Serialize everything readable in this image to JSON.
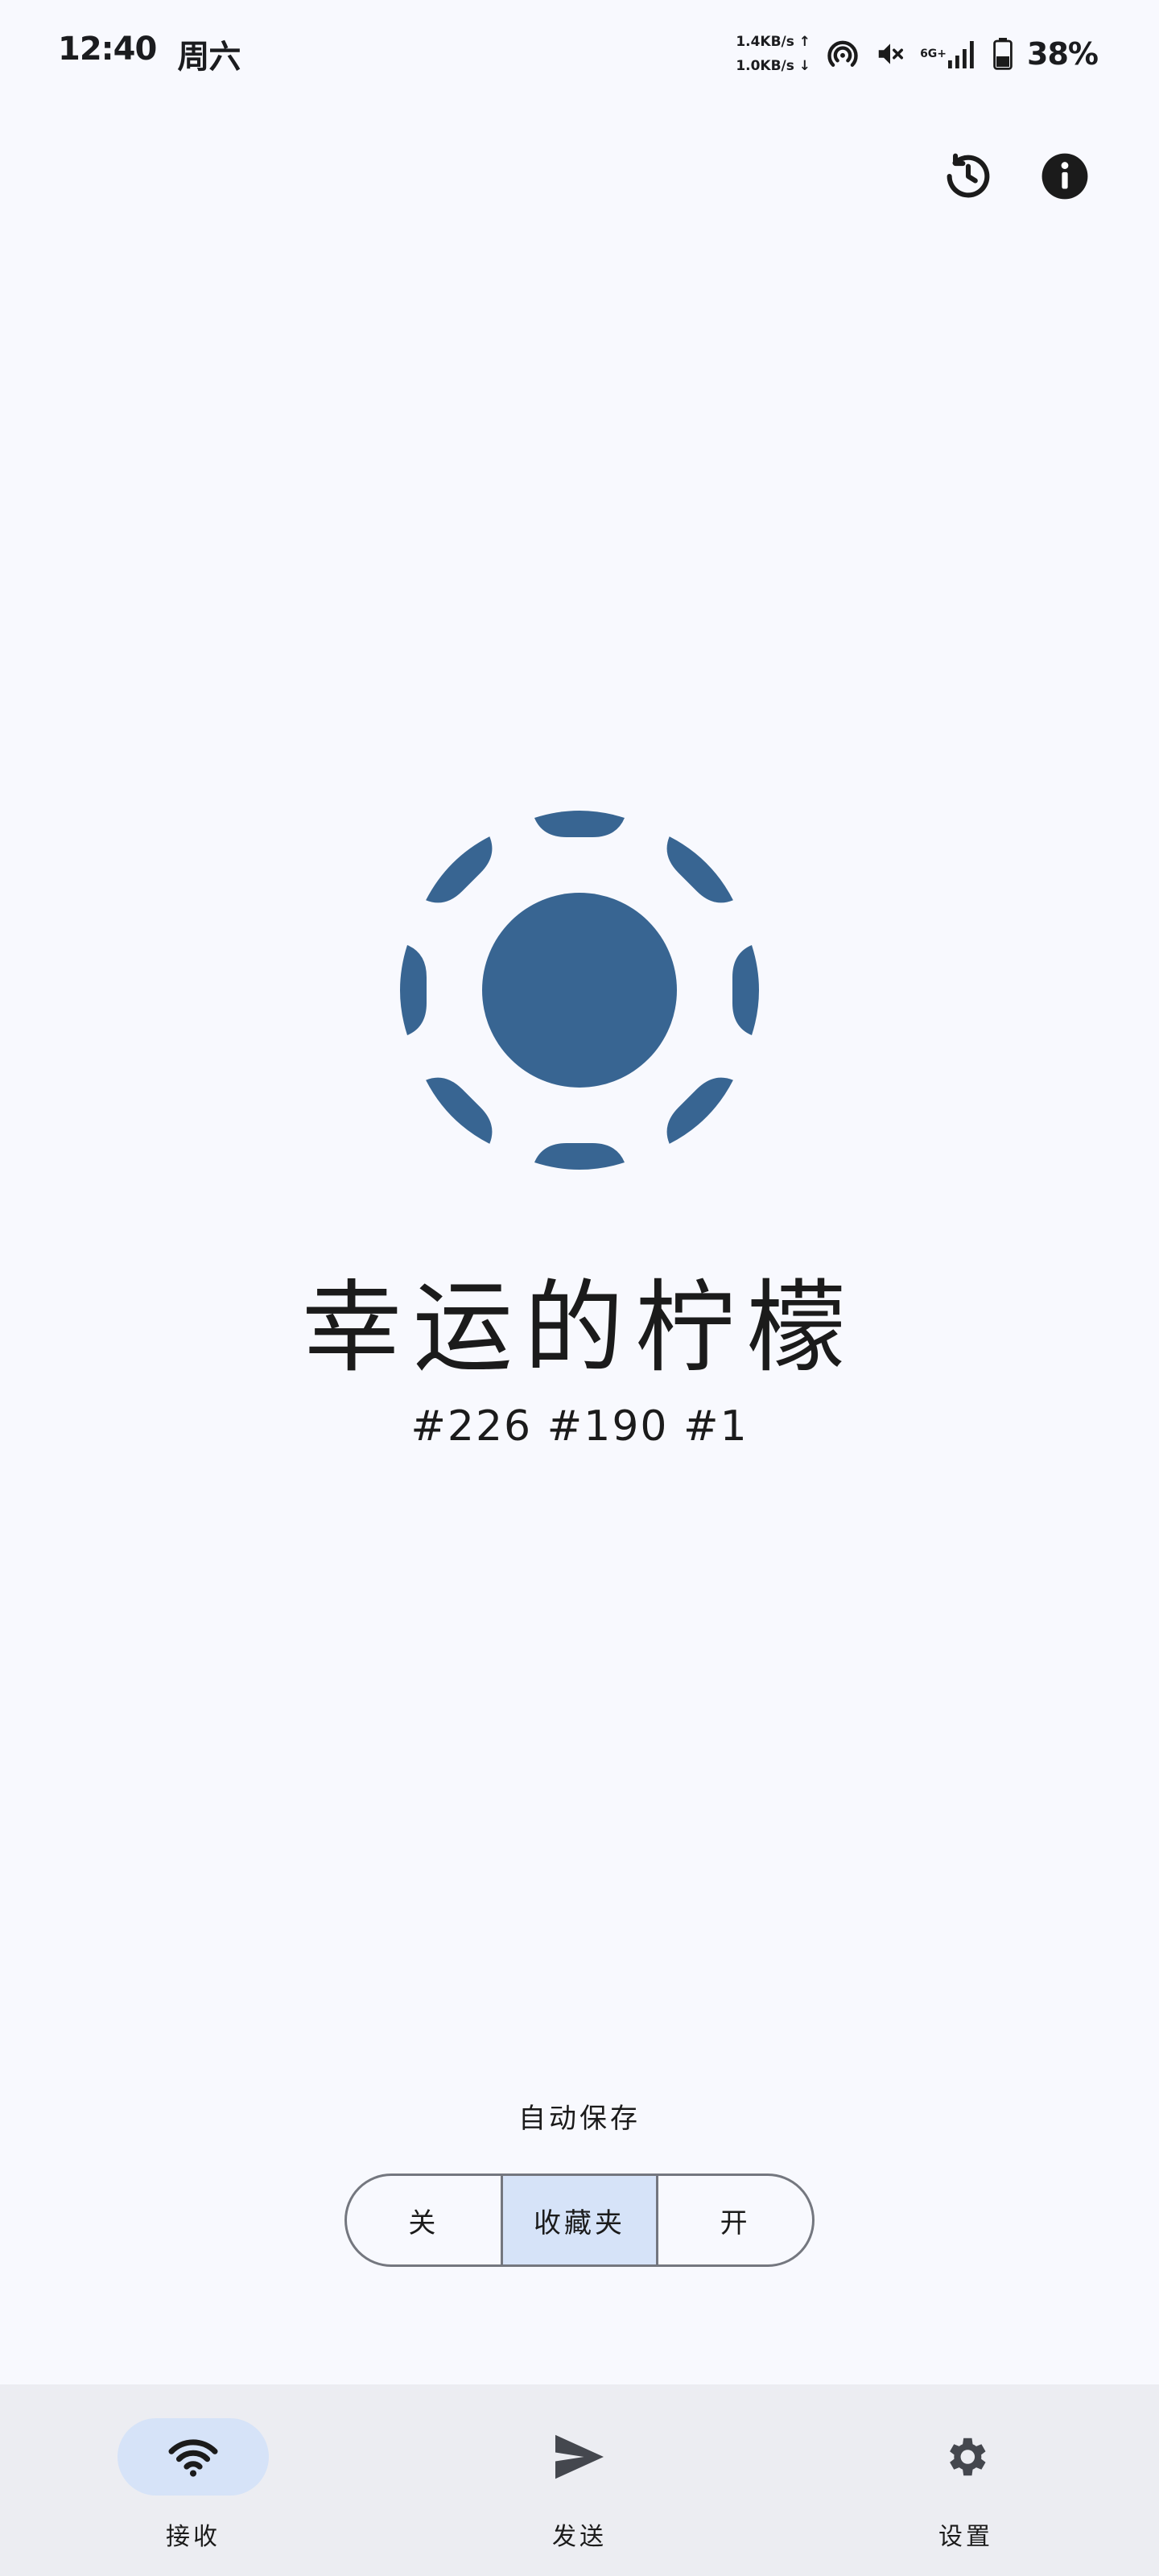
{
  "status_bar": {
    "time": "12:40",
    "day": "周六",
    "upload_speed": "1.4KB/s ↑",
    "download_speed": "1.0KB/s ↓",
    "signal_label": "6G+",
    "battery": "38%"
  },
  "top_actions": {
    "history_icon": "history-icon",
    "info_icon": "info-icon"
  },
  "device": {
    "name": "幸运的柠檬",
    "ids": "#226 #190 #1",
    "logo_color": "#386592"
  },
  "auto_save": {
    "label": "自动保存",
    "options": [
      "关",
      "收藏夹",
      "开"
    ],
    "selected": "收藏夹"
  },
  "bottom_nav": {
    "items": [
      {
        "label": "接收",
        "icon": "wifi-icon",
        "active": true
      },
      {
        "label": "发送",
        "icon": "send-icon",
        "active": false
      },
      {
        "label": "设置",
        "icon": "gear-icon",
        "active": false
      }
    ]
  },
  "colors": {
    "background": "#f8f9fe",
    "accent": "#386592",
    "selected_bg": "#d6e3f8",
    "nav_bg": "#ecedf2"
  }
}
